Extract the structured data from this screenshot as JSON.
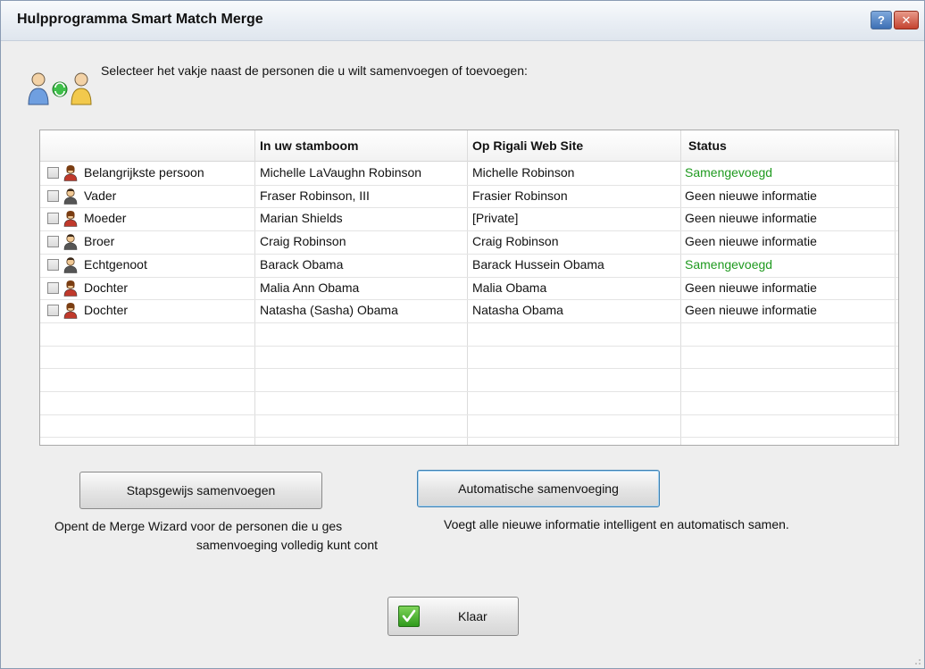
{
  "window": {
    "title": "Hulpprogramma Smart Match Merge",
    "help_glyph": "?",
    "close_glyph": "✕"
  },
  "instruction": "Selecteer het vakje naast de personen die u wilt samenvoegen of toevoegen:",
  "table": {
    "headers": [
      "",
      "In uw stamboom",
      "Op Rigali Web Site",
      "Status"
    ],
    "rows": [
      {
        "relation": "Belangrijkste persoon",
        "tree": "Michelle LaVaughn Robinson",
        "web": "Michelle Robinson",
        "status": "Samengevoegd",
        "status_color": "#1f9a1f",
        "gender": "female"
      },
      {
        "relation": "Vader",
        "tree": "Fraser Robinson, III",
        "web": "Frasier Robinson",
        "status": "Geen nieuwe informatie",
        "status_color": "#111111",
        "gender": "male"
      },
      {
        "relation": "Moeder",
        "tree": "Marian Shields",
        "web": "[Private]",
        "status": "Geen nieuwe informatie",
        "status_color": "#111111",
        "gender": "female"
      },
      {
        "relation": "Broer",
        "tree": "Craig Robinson",
        "web": "Craig Robinson",
        "status": "Geen nieuwe informatie",
        "status_color": "#111111",
        "gender": "male"
      },
      {
        "relation": "Echtgenoot",
        "tree": "Barack Obama",
        "web": "Barack Hussein Obama",
        "status": "Samengevoegd",
        "status_color": "#1f9a1f",
        "gender": "male"
      },
      {
        "relation": "Dochter",
        "tree": "Malia Ann Obama",
        "web": "Malia Obama",
        "status": "Geen nieuwe informatie",
        "status_color": "#111111",
        "gender": "female"
      },
      {
        "relation": "Dochter",
        "tree": "Natasha (Sasha) Obama",
        "web": "Natasha Obama",
        "status": "Geen nieuwe informatie",
        "status_color": "#111111",
        "gender": "female"
      }
    ]
  },
  "buttons": {
    "stepwise": "Stapsgewijs samenvoegen",
    "automatic": "Automatische samenvoeging",
    "done": "Klaar"
  },
  "descriptions": {
    "stepwise_line1": "Opent de Merge Wizard voor de personen die u ges",
    "stepwise_line2": "samenvoeging volledig kunt cont",
    "automatic": "Voegt alle nieuwe informatie intelligent en automatisch samen."
  },
  "icons": {
    "header": "people-merge-icon",
    "row": "person-icon",
    "done": "checkmark-icon"
  },
  "colors": {
    "merged_status": "#1f9a1f",
    "title_bar": "#e9eef4",
    "window_bg": "#eeeeee"
  }
}
